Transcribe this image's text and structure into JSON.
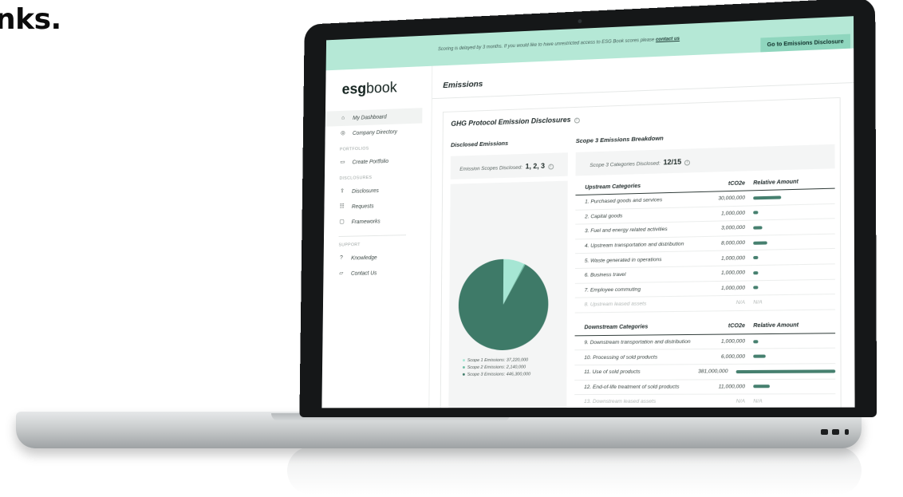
{
  "headline": "nks.",
  "banner": {
    "text": "Scoring is delayed by 3 months. If you would like to have unrestricted access to ESG Book scores please",
    "link": "contact us",
    "button": "Go to Emissions Disclosure"
  },
  "sidebar": {
    "logo_bold": "esg",
    "logo_light": "book",
    "items_top": [
      {
        "label": "My Dashboard",
        "icon": "home-icon"
      },
      {
        "label": "Company Directory",
        "icon": "search-icon"
      }
    ],
    "section_portfolios": "PORTFOLIOS",
    "items_portfolios": [
      {
        "label": "Create Portfolio",
        "icon": "document-icon"
      }
    ],
    "section_disclosures": "DISCLOSURES",
    "items_disclosures": [
      {
        "label": "Disclosures",
        "icon": "upload-icon"
      },
      {
        "label": "Requests",
        "icon": "list-icon"
      },
      {
        "label": "Frameworks",
        "icon": "folder-icon"
      }
    ],
    "section_support": "SUPPORT",
    "items_support": [
      {
        "label": "Knowledge",
        "icon": "question-icon"
      },
      {
        "label": "Contact Us",
        "icon": "chat-icon"
      }
    ]
  },
  "main": {
    "title": "Emissions",
    "panel_title": "GHG Protocol Emission Disclosures",
    "disclosed": {
      "title": "Disclosed Emissions",
      "scopes_label": "Emission Scopes Disclosed:",
      "scopes_value": "1, 2, 3"
    },
    "scope3": {
      "title": "Scope 3 Emissions Breakdown",
      "categories_label": "Scope 3 Categories Disclosed:",
      "categories_value": "12/15"
    },
    "colors": {
      "scope1": "#a6e6d4",
      "scope2": "#6fbfa5",
      "scope3": "#3e7a68",
      "bar": "#46806f"
    },
    "upstream": {
      "headers": [
        "Upstream Categories",
        "tCO2e",
        "Relative Amount"
      ],
      "rows": [
        {
          "name": "1. Purchased goods and services",
          "value": "30,000,000",
          "amount": 30000000,
          "muted": false
        },
        {
          "name": "2. Capital goods",
          "value": "1,000,000",
          "amount": 1000000,
          "muted": false
        },
        {
          "name": "3. Fuel and energy related activities",
          "value": "3,000,000",
          "amount": 3000000,
          "muted": false
        },
        {
          "name": "4. Upstream transportation and distribution",
          "value": "8,000,000",
          "amount": 8000000,
          "muted": false
        },
        {
          "name": "5. Waste generated in operations",
          "value": "1,000,000",
          "amount": 1000000,
          "muted": false
        },
        {
          "name": "6. Business travel",
          "value": "1,000,000",
          "amount": 1000000,
          "muted": false
        },
        {
          "name": "7. Employee commuting",
          "value": "1,000,000",
          "amount": 1000000,
          "muted": false
        },
        {
          "name": "8. Upstream leased assets",
          "value": "N/A",
          "amount": null,
          "muted": true,
          "rel": "N/A"
        }
      ]
    },
    "downstream": {
      "headers": [
        "Downstream Categories",
        "tCO2e",
        "Relative Amount"
      ],
      "rows": [
        {
          "name": "9. Downstream transportation and distribution",
          "value": "1,000,000",
          "amount": 1000000,
          "muted": false
        },
        {
          "name": "10. Processing of sold products",
          "value": "6,000,000",
          "amount": 6000000,
          "muted": false
        },
        {
          "name": "11. Use of sold products",
          "value": "381,000,000",
          "amount": 381000000,
          "muted": false
        },
        {
          "name": "12. End-of-life treatment of sold products",
          "value": "11,000,000",
          "amount": 11000000,
          "muted": false
        },
        {
          "name": "13. Downstream leased assets",
          "value": "N/A",
          "amount": null,
          "muted": true,
          "rel": "N/A"
        }
      ]
    }
  },
  "chart_data": {
    "type": "pie",
    "categories": [
      "Scope 1 Emissions: 37,220,000",
      "Scope 2 Emissions: 2,140,000",
      "Scope 3 Emissions: 446,300,000"
    ],
    "values": [
      37220000,
      2140000,
      446300000
    ],
    "colors": [
      "#a6e6d4",
      "#6fbfa5",
      "#3e7a68"
    ]
  }
}
